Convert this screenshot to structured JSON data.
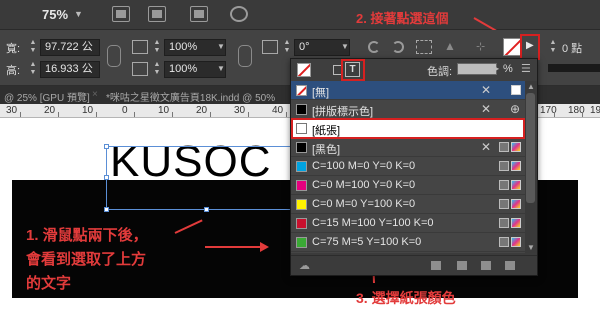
{
  "menubar": {
    "zoom": "75%",
    "zoom_arrow": "▼",
    "step2_annotation": "2. 接著點選這個"
  },
  "control_panel": {
    "width_label": "寬:",
    "width_value": "97.722 公",
    "height_label": "高:",
    "height_value": "16.933 公",
    "scale_x": "100%",
    "scale_y": "100%",
    "rotation": "0°",
    "stroke_value": "0 點"
  },
  "tabs": {
    "tab1": "@ 25% [GPU 預覽]",
    "tab2": "*咪咕之星徵文廣告頁18K.indd @ 50%"
  },
  "ruler": {
    "marks": [
      "30",
      "20",
      "10",
      "0",
      "10",
      "20",
      "30",
      "40",
      "170",
      "180",
      "190"
    ]
  },
  "canvas": {
    "big_text": "KUSOC",
    "step1_annotation": [
      "1. 滑鼠點兩下後，",
      "會看到選取了上方",
      "的文字"
    ],
    "step3_annotation": "3. 選擇紙張顏色"
  },
  "swatches_panel": {
    "text_button": "T",
    "tint_label": "色調:",
    "tint_unit": "%",
    "rows": [
      {
        "name": "[無]",
        "color": "#ffffff",
        "kind": "none"
      },
      {
        "name": "[拼版標示色]",
        "color": "#000000",
        "kind": "registration"
      },
      {
        "name": "[紙張]",
        "color": "#ffffff",
        "kind": "paper"
      },
      {
        "name": "[黑色]",
        "color": "#000000",
        "kind": "black"
      },
      {
        "name": "C=100 M=0 Y=0 K=0",
        "color": "#00a3e0",
        "kind": "process"
      },
      {
        "name": "C=0 M=100 Y=0 K=0",
        "color": "#e6007e",
        "kind": "process"
      },
      {
        "name": "C=0 M=0 Y=100 K=0",
        "color": "#fff200",
        "kind": "process"
      },
      {
        "name": "C=15 M=100 Y=100 K=0",
        "color": "#c8102e",
        "kind": "process"
      },
      {
        "name": "C=75 M=5 Y=100 K=0",
        "color": "#3aa935",
        "kind": "process"
      }
    ]
  }
}
